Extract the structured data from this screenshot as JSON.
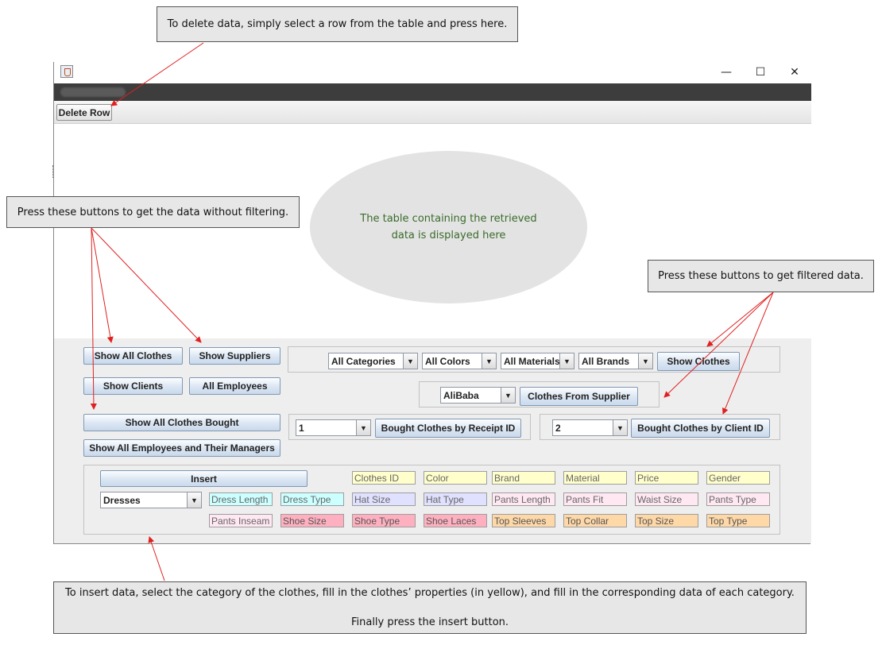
{
  "annotations": {
    "delete_note": "To delete data, simply select a row from the table and press here.",
    "unfiltered_note": "Press these buttons to get the data without filtering.",
    "filtered_note": "Press these buttons to get filtered data.",
    "table_note": "The table containing the retrieved data is displayed here",
    "insert_note_line1": "To insert data, select the category of the clothes, fill in the clothes’ properties (in yellow), and fill in the corresponding data of each category.",
    "insert_note_line2": "Finally press the insert button."
  },
  "window": {
    "controls": {
      "minimize": "—",
      "maximize": "☐",
      "close": "✕"
    }
  },
  "toolbar": {
    "delete_row_label": "Delete Row"
  },
  "unfiltered_buttons": {
    "show_all_clothes": "Show All Clothes",
    "show_suppliers": "Show Suppliers",
    "show_clients": "Show Clients",
    "all_employees": "All Employees",
    "show_all_clothes_bought": "Show All Clothes Bought",
    "show_employees_managers": "Show All Employees and Their Managers"
  },
  "filters": {
    "category": "All Categories",
    "color": "All Colors",
    "material": "All Materials",
    "brand": "All Brands",
    "show_clothes_label": "Show Clothes",
    "supplier": "AliBaba",
    "clothes_from_supplier_label": "Clothes From Supplier",
    "receipt_id": "1",
    "bought_by_receipt_label": "Bought Clothes by Receipt ID",
    "client_id": "2",
    "bought_by_client_label": "Bought Clothes by Client ID"
  },
  "insert": {
    "button_label": "Insert",
    "category": "Dresses",
    "fields": {
      "clothes_id": "Clothes ID",
      "color": "Color",
      "brand": "Brand",
      "material": "Material",
      "price": "Price",
      "gender": "Gender",
      "dress_length": "Dress Length",
      "dress_type": "Dress Type",
      "hat_size": "Hat Size",
      "hat_type": "Hat Type",
      "pants_length": "Pants Length",
      "pants_fit": "Pants Fit",
      "waist_size": "Waist Size",
      "pants_type": "Pants Type",
      "pants_inseam": "Pants Inseam",
      "shoe_size": "Shoe Size",
      "shoe_type": "Shoe Type",
      "shoe_laces": "Shoe Laces",
      "top_sleeves": "Top Sleeves",
      "top_collar": "Top Collar",
      "top_size": "Top Size",
      "top_type": "Top Type"
    }
  },
  "colors": {
    "callout_bg": "#e7e7e7",
    "arrow": "#e02020",
    "table_note_text": "#3a6b2a",
    "property_yellow": "#ffffcc",
    "dress_cyan": "#ccffff",
    "hat_lavender": "#e0e0ff",
    "pants_pink": "#ffe8f2",
    "shoe_rose": "#ffb0c0",
    "top_orange": "#ffd8a8"
  }
}
